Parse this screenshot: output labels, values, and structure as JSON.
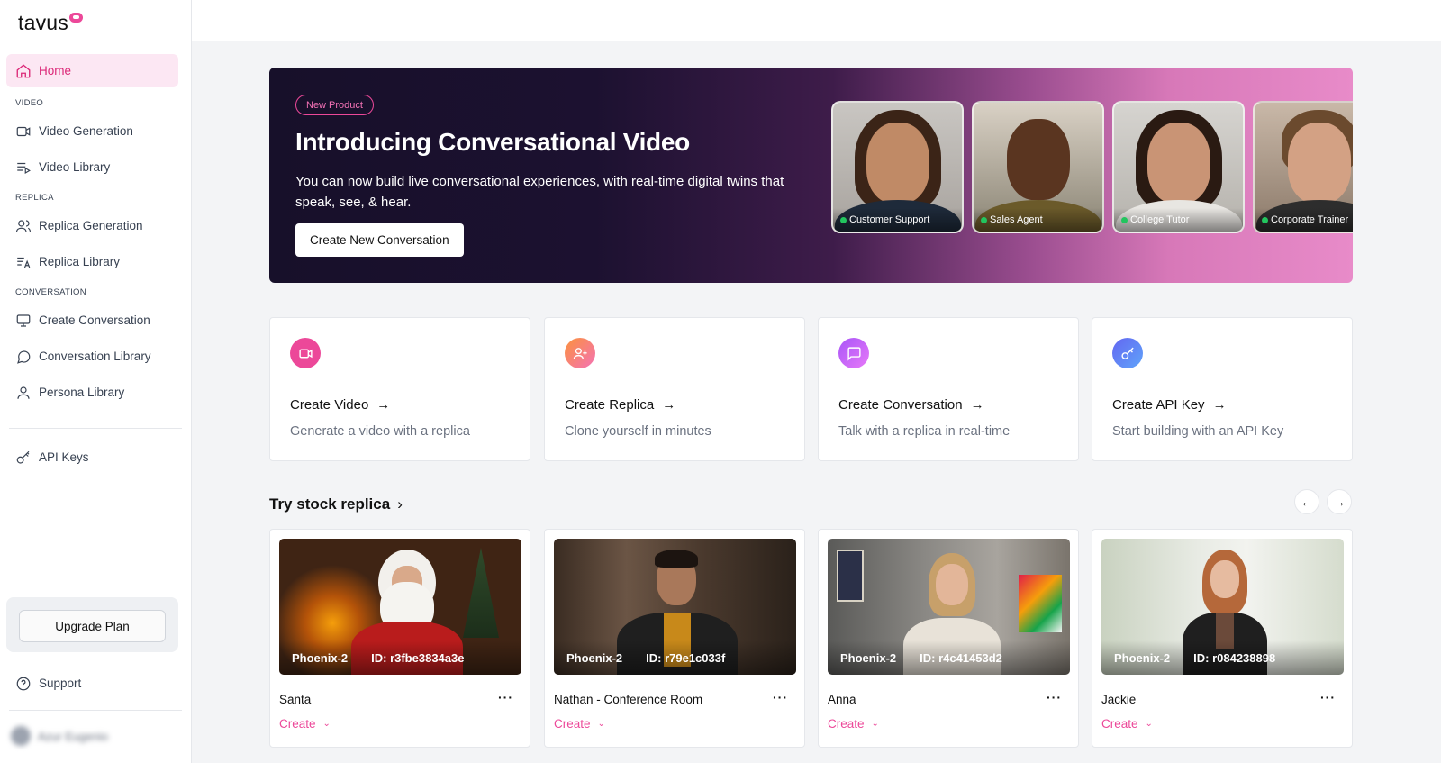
{
  "brand": {
    "logo_text": "tavus",
    "accent": "#ec4899"
  },
  "sidebar": {
    "home": "Home",
    "sections": {
      "video": "VIDEO",
      "replica": "REPLICA",
      "conversation": "CONVERSATION"
    },
    "items": {
      "video_generation": "Video Generation",
      "video_library": "Video Library",
      "replica_generation": "Replica Generation",
      "replica_library": "Replica Library",
      "create_conversation": "Create Conversation",
      "conversation_library": "Conversation Library",
      "persona_library": "Persona Library",
      "api_keys": "API Keys"
    },
    "upgrade": "Upgrade Plan",
    "support": "Support",
    "user_name": "Azur Eugenio"
  },
  "hero": {
    "badge": "New Product",
    "title": "Introducing Conversational Video",
    "subtitle": "You can now build live conversational experiences, with real-time digital twins that speak, see, & hear.",
    "cta": "Create New Conversation",
    "personas": [
      "Customer Support",
      "Sales Agent",
      "College Tutor",
      "Corporate Trainer"
    ]
  },
  "actions": [
    {
      "title": "Create Video",
      "desc": "Generate a video with a replica",
      "color": "#ec4899"
    },
    {
      "title": "Create Replica",
      "desc": "Clone yourself in minutes",
      "color": "#f97316"
    },
    {
      "title": "Create Conversation",
      "desc": "Talk with a replica in real-time",
      "color": "#a855f7"
    },
    {
      "title": "Create API Key",
      "desc": "Start building with an API Key",
      "color": "#6366f1"
    }
  ],
  "stock": {
    "title": "Try stock replica",
    "replicas": [
      {
        "model": "Phoenix-2",
        "id": "ID: r3fbe3834a3e",
        "name": "Santa",
        "create": "Create"
      },
      {
        "model": "Phoenix-2",
        "id": "ID: r79e1c033f",
        "name": "Nathan - Conference Room",
        "create": "Create"
      },
      {
        "model": "Phoenix-2",
        "id": "ID: r4c41453d2",
        "name": "Anna",
        "create": "Create"
      },
      {
        "model": "Phoenix-2",
        "id": "ID: r084238898",
        "name": "Jackie",
        "create": "Create"
      }
    ]
  }
}
